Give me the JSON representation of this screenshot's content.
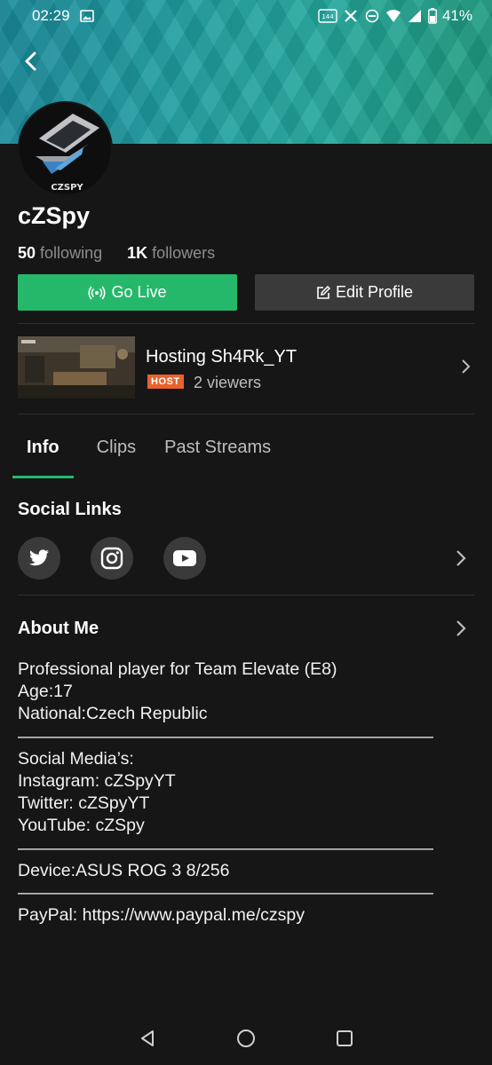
{
  "status_bar": {
    "time": "02:29",
    "battery": "41%",
    "icons": [
      "image-icon",
      "hz-icon",
      "x-icon",
      "dnd-icon",
      "wifi-icon",
      "signal-icon",
      "battery-icon"
    ],
    "hz_label": "144 Hz"
  },
  "banner": {
    "colors": [
      "#1a8a9a",
      "#23a79c",
      "#1f9a7f"
    ]
  },
  "avatar": {
    "logo_text": "CZSPY"
  },
  "profile": {
    "username": "cZSpy",
    "following_count": "50",
    "following_label": "following",
    "followers_count": "1K",
    "followers_label": "followers"
  },
  "actions": {
    "go_live": "Go Live",
    "edit_profile": "Edit Profile",
    "go_live_color": "#25b86b"
  },
  "hosting": {
    "title": "Hosting Sh4Rk_YT",
    "badge": "HOST",
    "viewers": "2 viewers",
    "badge_color": "#e8622c"
  },
  "tabs": [
    {
      "label": "Info",
      "active": true
    },
    {
      "label": "Clips",
      "active": false
    },
    {
      "label": "Past Streams",
      "active": false
    }
  ],
  "social_links": {
    "title": "Social Links",
    "icons": [
      "twitter-icon",
      "instagram-icon",
      "youtube-icon"
    ]
  },
  "about": {
    "title": "About Me",
    "text": "Professional player for Team Elevate (E8)\nAge:17\nNational:Czech Republic\n————————————————————————\nSocial Media’s:\nInstagram: cZSpyYT\nTwitter: cZSpyYT\nYouTube: cZSpy\n————————————————————————\nDevice:ASUS ROG 3 8/256\n————————————————————————\nPayPal: https://www.paypal.me/czspy"
  },
  "nav": [
    "back-triangle-icon",
    "home-circle-icon",
    "recents-square-icon"
  ]
}
